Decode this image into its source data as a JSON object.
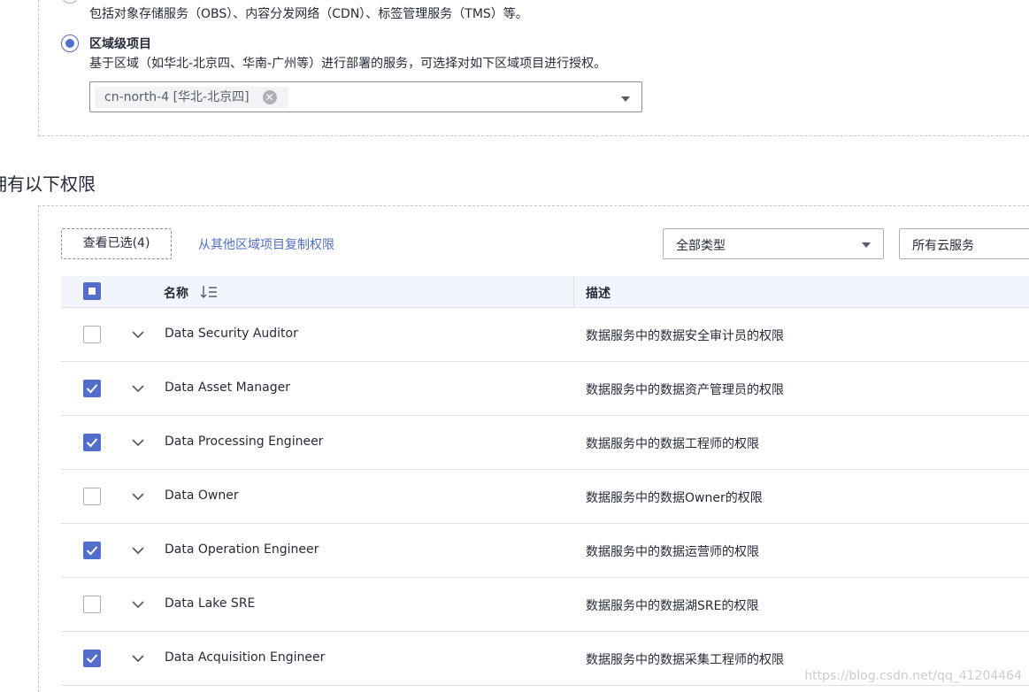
{
  "scope": {
    "global_desc": "包括对象存储服务（OBS）、内容分发网络（CDN）、标签管理服务（TMS）等。",
    "region_title": "区域级项目",
    "region_desc": "基于区域（如华北-北京四、华南-广州等）进行部署的服务，可选择对如下区域项目进行授权。",
    "selected_region": "cn-north-4 [华北-北京四]",
    "tag_close_glyph": "✕"
  },
  "section_title": "拥有以下权限",
  "toolbar": {
    "view_selected": "查看已选(4)",
    "copy_link": "从其他区域项目复制权限",
    "type_select": "全部类型",
    "service_select": "所有云服务"
  },
  "table": {
    "col_name": "名称",
    "col_desc": "描述",
    "rows": [
      {
        "name": "Data Security Auditor",
        "desc": "数据服务中的数据安全审计员的权限",
        "checked": false
      },
      {
        "name": "Data Asset Manager",
        "desc": "数据服务中的数据资产管理员的权限",
        "checked": true
      },
      {
        "name": "Data Processing Engineer",
        "desc": "数据服务中的数据工程师的权限",
        "checked": true
      },
      {
        "name": "Data Owner",
        "desc": "数据服务中的数据Owner的权限",
        "checked": false
      },
      {
        "name": "Data Operation Engineer",
        "desc": "数据服务中的数据运营师的权限",
        "checked": true
      },
      {
        "name": "Data Lake SRE",
        "desc": "数据服务中的数据湖SRE的权限",
        "checked": false
      },
      {
        "name": "Data Acquisition Engineer",
        "desc": "数据服务中的数据采集工程师的权限",
        "checked": true
      }
    ]
  },
  "watermark": "https://blog.csdn.net/qq_41204464",
  "colors": {
    "accent": "#526ecc",
    "header_bg": "#f3f5fc",
    "border": "#dfe1e6"
  }
}
